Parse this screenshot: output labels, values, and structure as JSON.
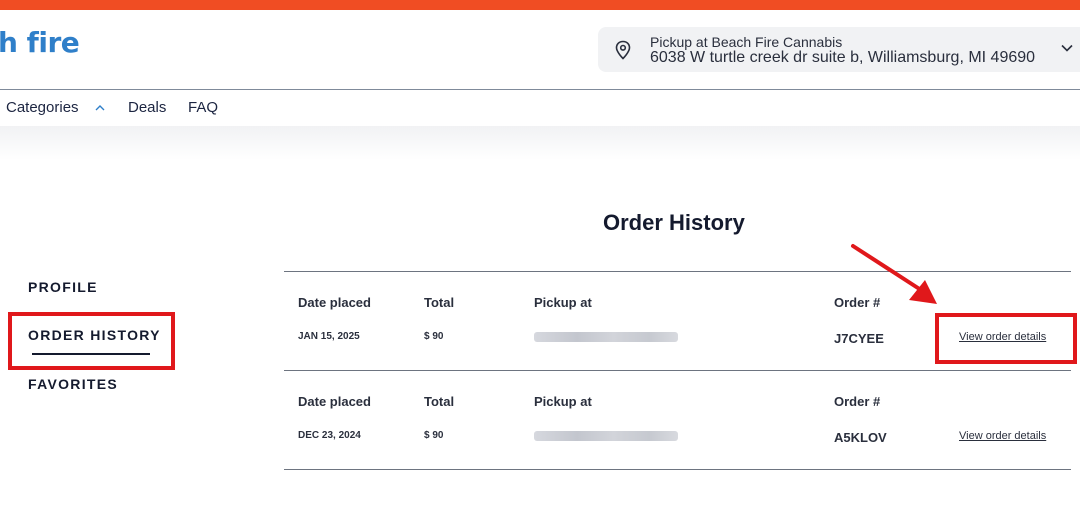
{
  "brand": {
    "logo_text": "h fire",
    "accent_color": "#f04d23",
    "logo_color": "#2f7fc9"
  },
  "header": {
    "pickup_label": "Pickup at Beach Fire Cannabis",
    "pickup_address": "6038 W turtle creek dr suite b, Williamsburg, MI 49690",
    "location_icon": "map-pin-icon",
    "expand_icon": "chevron-down-icon"
  },
  "nav": {
    "items": [
      {
        "label": "Categories",
        "icon": "chevron-up-icon"
      },
      {
        "label": "Deals"
      },
      {
        "label": "FAQ"
      }
    ]
  },
  "sidebar": {
    "items": [
      {
        "label": "PROFILE"
      },
      {
        "label": "ORDER HISTORY",
        "active": true
      },
      {
        "label": "FAVORITES"
      }
    ]
  },
  "main": {
    "title": "Order History",
    "columns": {
      "date": "Date placed",
      "total": "Total",
      "pickup": "Pickup at",
      "order": "Order #"
    },
    "orders": [
      {
        "date": "JAN 15, 2025",
        "total": "$ 90",
        "order_number": "J7CYEE",
        "link": "View order details"
      },
      {
        "date": "DEC 23, 2024",
        "total": "$ 90",
        "order_number": "A5KLOV",
        "link": "View order details"
      }
    ]
  },
  "annotation": {
    "highlight_color": "#e0181b"
  }
}
